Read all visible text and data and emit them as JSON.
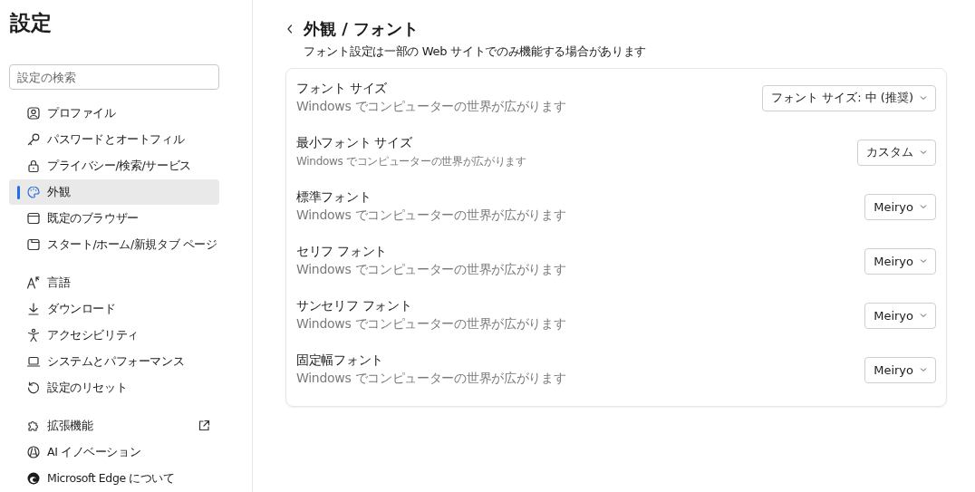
{
  "sidebar": {
    "title": "設定",
    "search": {
      "placeholder": "設定の検索"
    },
    "groups": [
      [
        {
          "label": "プロファイル",
          "selected": false,
          "external_link": false
        },
        {
          "label": "パスワードとオートフィル",
          "selected": false,
          "external_link": false
        },
        {
          "label": "プライバシー/検索/サービス",
          "selected": false,
          "external_link": false
        },
        {
          "label": "外観",
          "selected": true,
          "external_link": false
        },
        {
          "label": "既定のブラウザー",
          "selected": false,
          "external_link": false
        },
        {
          "label": "スタート/ホーム/新規タブ ページ",
          "selected": false,
          "external_link": false
        }
      ],
      [
        {
          "label": "言語",
          "selected": false,
          "external_link": false
        },
        {
          "label": "ダウンロード",
          "selected": false,
          "external_link": false
        },
        {
          "label": "アクセシビリティ",
          "selected": false,
          "external_link": false
        },
        {
          "label": "システムとパフォーマンス",
          "selected": false,
          "external_link": false
        },
        {
          "label": "設定のリセット",
          "selected": false,
          "external_link": false
        }
      ],
      [
        {
          "label": "拡張機能",
          "selected": false,
          "external_link": true
        },
        {
          "label": "AI イノベーション",
          "selected": false,
          "external_link": false
        },
        {
          "label": "Microsoft Edge について",
          "selected": false,
          "external_link": false
        }
      ]
    ]
  },
  "page": {
    "breadcrumb": [
      "外観",
      "/",
      "フォント"
    ],
    "subtitle": "フォント設定は一部の Web サイトでのみ機能する場合があります",
    "rows": [
      {
        "kind": "normal",
        "label": "フォント サイズ",
        "description": "Windows でコンピューターの世界が広がります",
        "value": "フォント サイズ: 中 (推奨)"
      },
      {
        "kind": "small",
        "label": "最小フォント サイズ",
        "description": "Windows でコンピューターの世界が広がります",
        "value": "カスタム"
      },
      {
        "kind": "normal",
        "label": "標準フォント",
        "description": "Windows でコンピューターの世界が広がります",
        "value": "Meiryo"
      },
      {
        "kind": "normal",
        "label": "セリフ フォント",
        "description": "Windows でコンピューターの世界が広がります",
        "value": "Meiryo"
      },
      {
        "kind": "normal",
        "label": "サンセリフ フォント",
        "description": "Windows でコンピューターの世界が広がります",
        "value": "Meiryo"
      },
      {
        "kind": "normal",
        "label": "固定幅フォント",
        "description": "Windows でコンピューターの世界が広がります",
        "value": "Meiryo"
      }
    ]
  }
}
